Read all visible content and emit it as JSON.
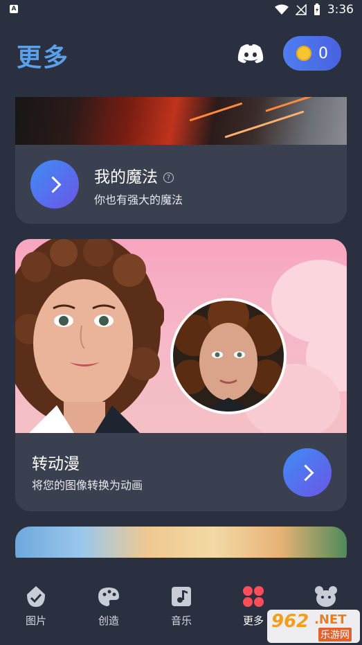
{
  "status_bar": {
    "time": "3:36"
  },
  "header": {
    "title": "更多",
    "coin_count": "0"
  },
  "cards": [
    {
      "title": "我的魔法",
      "subtitle": "你也有强大的魔法",
      "help": "?"
    },
    {
      "title": "转动漫",
      "subtitle": "将您的图像转换为动画"
    }
  ],
  "nav": {
    "items": [
      {
        "label": "图片",
        "icon": "picture-icon"
      },
      {
        "label": "创造",
        "icon": "palette-icon"
      },
      {
        "label": "音乐",
        "icon": "music-icon"
      },
      {
        "label": "更多",
        "icon": "grid-dots-icon",
        "active": true
      },
      {
        "label": "",
        "icon": "bear-icon"
      }
    ]
  },
  "watermark": {
    "num": "962",
    "net": ".NET",
    "sub": "乐游网"
  },
  "colors": {
    "accent": "#5aa0ea",
    "button_gradient_start": "#3f8df5",
    "button_gradient_end": "#6b55e6",
    "background": "#2b3040",
    "card": "#3a4050",
    "active_nav": "#ff4d5a"
  }
}
